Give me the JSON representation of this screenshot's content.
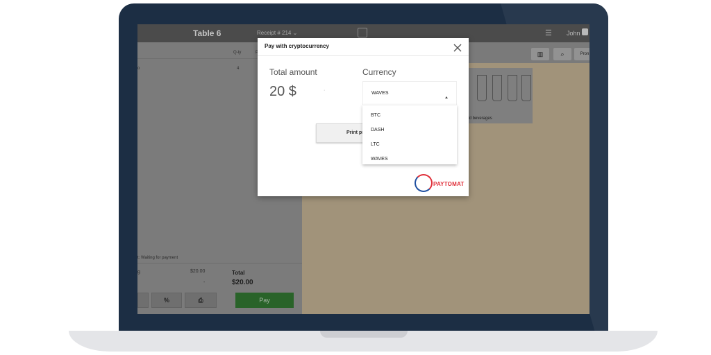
{
  "app": {
    "table_title": "Table 6",
    "receipt": "Receipt # 214 ⌄",
    "menu_icon": "hamburger-icon",
    "user": "John",
    "lock_icon": "lock-icon"
  },
  "order": {
    "col_qty": "Q-ty",
    "col_extra": "P",
    "row_name": "o",
    "row_qty": "4",
    "status": "t: Waiting for payment",
    "subtotal_left": "g",
    "subtotal_amount": "$20.00",
    "subtotal_dash": "-",
    "total_label": "Total",
    "total_value": "$20.00",
    "percent_button": "%",
    "print_icon": "printer-icon",
    "pay_button": "Pay"
  },
  "catalog": {
    "barcode_icon": "barcode-icon",
    "search_icon": "search-icon",
    "promo_button": "Pron",
    "tile_label": "old beverages"
  },
  "dialog": {
    "title": "Pay with cryptocurrency",
    "close_icon": "close-icon",
    "total_amount_label": "Total amount",
    "total_amount_value": "20 $",
    "amount_dot": "·",
    "currency_label": "Currency",
    "selected_currency": "WAVES",
    "currency_options": [
      "BTC",
      "DASH",
      "LTC",
      "WAVES"
    ],
    "print_button": "Print pr",
    "logo_text": "PAYTOMAT"
  },
  "colors": {
    "laptop_frame": "#1c2e44",
    "pay_green": "#2e6f2e",
    "paytomat_red": "#e0303a",
    "paytomat_blue": "#1f4fa0"
  }
}
